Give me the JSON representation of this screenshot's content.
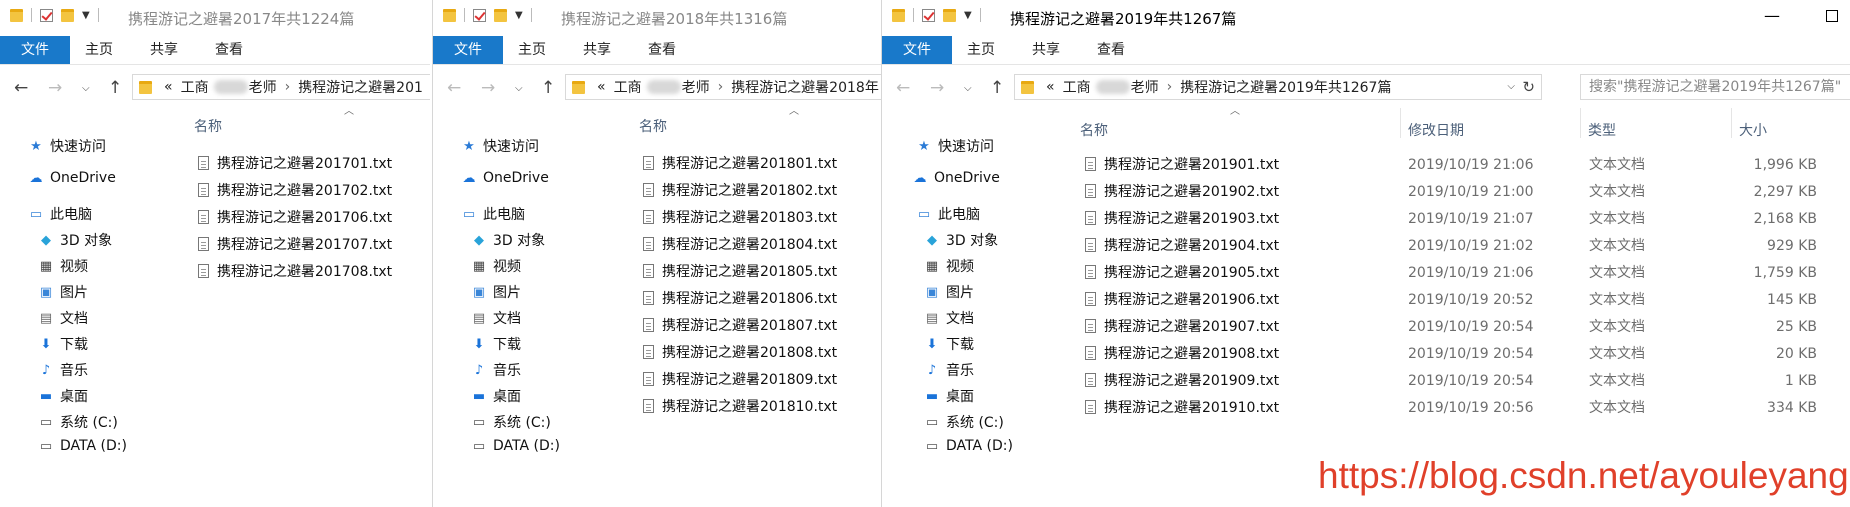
{
  "ribbon_tabs": [
    "文件",
    "主页",
    "共享",
    "查看"
  ],
  "nav": {
    "quick_access": "快速访问",
    "onedrive": "OneDrive",
    "this_pc": "此电脑",
    "objects_3d": "3D 对象",
    "videos": "视频",
    "pictures": "图片",
    "documents": "文档",
    "downloads": "下载",
    "music": "音乐",
    "desktop": "桌面",
    "drive_c": "系统 (C:)",
    "drive_d": "DATA (D:)"
  },
  "columns": {
    "name": "名称",
    "modified": "修改日期",
    "type": "类型",
    "size": "大小"
  },
  "windows": [
    {
      "title": "携程游记之避暑2017年共1224篇",
      "crumbs": [
        "«",
        "工商",
        "老师",
        "›",
        "携程游记之避暑201"
      ],
      "files": [
        "携程游记之避暑201701.txt",
        "携程游记之避暑201702.txt",
        "携程游记之避暑201706.txt",
        "携程游记之避暑201707.txt",
        "携程游记之避暑201708.txt"
      ]
    },
    {
      "title": "携程游记之避暑2018年共1316篇",
      "crumbs": [
        "«",
        "工商",
        "老师",
        "›",
        "携程游记之避暑2018年"
      ],
      "files": [
        "携程游记之避暑201801.txt",
        "携程游记之避暑201802.txt",
        "携程游记之避暑201803.txt",
        "携程游记之避暑201804.txt",
        "携程游记之避暑201805.txt",
        "携程游记之避暑201806.txt",
        "携程游记之避暑201807.txt",
        "携程游记之避暑201808.txt",
        "携程游记之避暑201809.txt",
        "携程游记之避暑201810.txt"
      ]
    },
    {
      "title": "携程游记之避暑2019年共1267篇",
      "crumbs": [
        "«",
        "工商",
        "老师",
        "›",
        "携程游记之避暑2019年共1267篇"
      ],
      "search_placeholder": "搜索\"携程游记之避暑2019年共1267篇\"",
      "files": [
        {
          "name": "携程游记之避暑201901.txt",
          "modified": "2019/10/19 21:06",
          "type": "文本文档",
          "size": "1,996 KB"
        },
        {
          "name": "携程游记之避暑201902.txt",
          "modified": "2019/10/19 21:00",
          "type": "文本文档",
          "size": "2,297 KB"
        },
        {
          "name": "携程游记之避暑201903.txt",
          "modified": "2019/10/19 21:07",
          "type": "文本文档",
          "size": "2,168 KB"
        },
        {
          "name": "携程游记之避暑201904.txt",
          "modified": "2019/10/19 21:02",
          "type": "文本文档",
          "size": "929 KB"
        },
        {
          "name": "携程游记之避暑201905.txt",
          "modified": "2019/10/19 21:06",
          "type": "文本文档",
          "size": "1,759 KB"
        },
        {
          "name": "携程游记之避暑201906.txt",
          "modified": "2019/10/19 20:52",
          "type": "文本文档",
          "size": "145 KB"
        },
        {
          "name": "携程游记之避暑201907.txt",
          "modified": "2019/10/19 20:54",
          "type": "文本文档",
          "size": "25 KB"
        },
        {
          "name": "携程游记之避暑201908.txt",
          "modified": "2019/10/19 20:54",
          "type": "文本文档",
          "size": "20 KB"
        },
        {
          "name": "携程游记之避暑201909.txt",
          "modified": "2019/10/19 20:54",
          "type": "文本文档",
          "size": "1 KB"
        },
        {
          "name": "携程游记之避暑201910.txt",
          "modified": "2019/10/19 20:56",
          "type": "文本文档",
          "size": "334 KB"
        }
      ]
    }
  ],
  "watermark": "https://blog.csdn.net/ayouleyang",
  "colors": {
    "file_tab_bg": "#1979ca",
    "header_text": "#4c607a",
    "watermark": "#e0402a",
    "folder": "#f3c440"
  }
}
